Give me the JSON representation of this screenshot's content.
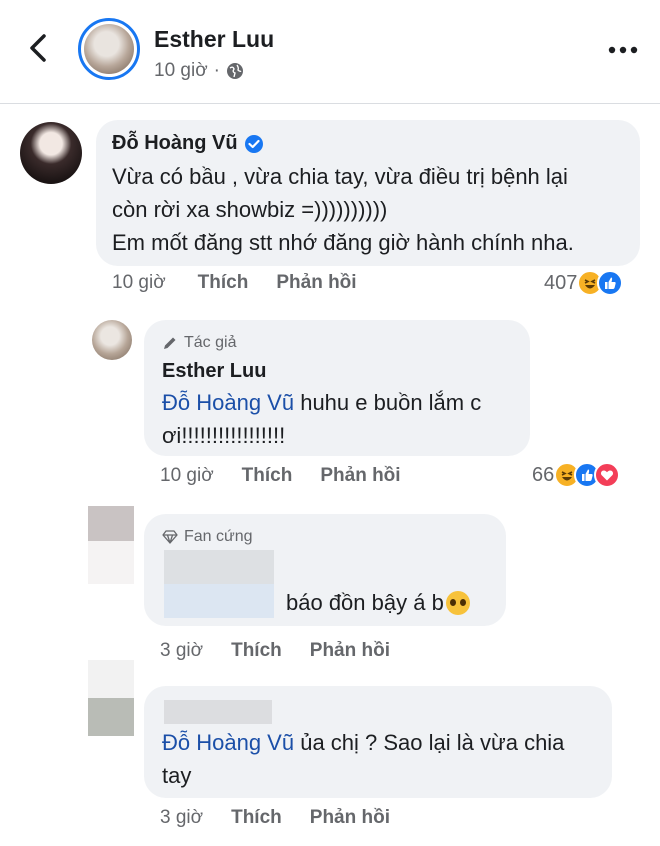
{
  "header": {
    "name": "Esther Luu",
    "time": "10 giờ"
  },
  "comments": [
    {
      "author": "Đỗ Hoàng Vũ",
      "line1": "Vừa có bầu , vừa chia tay, vừa điều trị bệnh lại",
      "line2": "còn rời xa showbiz =))))))))))",
      "line3": "Em mốt đăng stt nhớ đăng giờ hành chính nha.",
      "time": "10 giờ",
      "like": "Thích",
      "reply": "Phản hồi",
      "reaction_count": "407"
    },
    {
      "badge": "Tác giả",
      "author": "Esther Luu",
      "mention": "Đỗ Hoàng Vũ",
      "text1": " huhu e buồn lắm c",
      "text2": "ơi!!!!!!!!!!!!!!!!!",
      "time": "10 giờ",
      "like": "Thích",
      "reply": "Phản hồi",
      "reaction_count": "66"
    },
    {
      "badge": "Fan cứng",
      "text": "báo đồn bậy á b",
      "time": "3 giờ",
      "like": "Thích",
      "reply": "Phản hồi"
    },
    {
      "mention": "Đỗ Hoàng Vũ",
      "text1": " ủa chị ? Sao lại là vừa chia",
      "text2": "tay",
      "time": "3 giờ",
      "like": "Thích",
      "reply": "Phản hồi"
    }
  ],
  "colors": {
    "accent": "#1877f2",
    "mention": "#1b4fa8",
    "bubble": "#f0f2f5",
    "muted": "#65676b"
  },
  "icons": [
    "back-arrow-icon",
    "globe-icon",
    "more-dots-icon",
    "verified-badge-icon",
    "pen-icon",
    "diamond-icon",
    "haha-emoji-icon",
    "like-reaction-icon",
    "love-reaction-icon",
    "pleading-emoji-icon"
  ]
}
